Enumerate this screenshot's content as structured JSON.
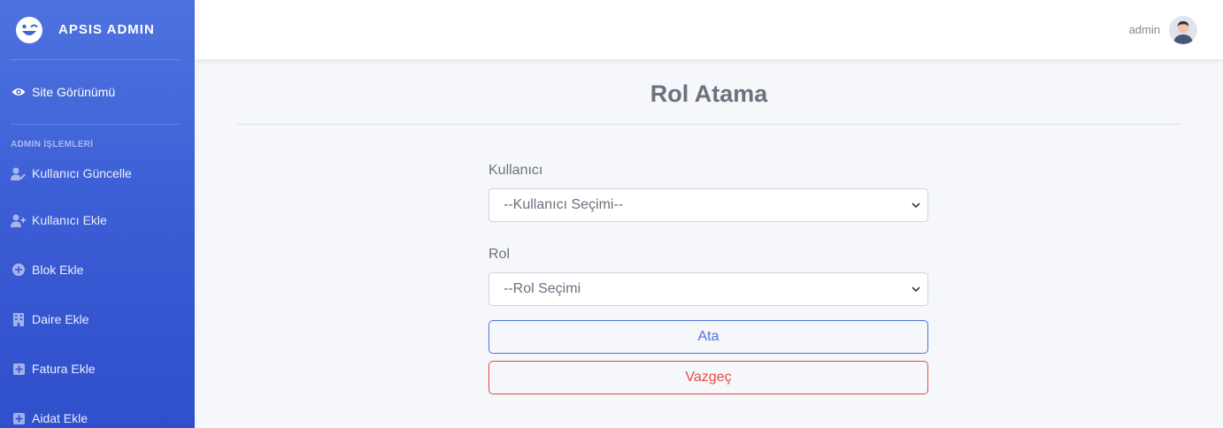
{
  "brand": {
    "name": "APSIS ADMIN"
  },
  "sidebar": {
    "active_item": {
      "label": "Site Görünümü",
      "icon": "eye-icon"
    },
    "heading": "ADMIN İŞLEMLERİ",
    "items": [
      {
        "label": "Kullanıcı Güncelle",
        "icon": "user-edit-icon"
      },
      {
        "label": "Kullanıcı Ekle",
        "icon": "user-plus-icon"
      },
      {
        "label": "Blok Ekle",
        "icon": "plus-circle-icon"
      },
      {
        "label": "Daire Ekle",
        "icon": "building-icon"
      },
      {
        "label": "Fatura Ekle",
        "icon": "plus-square-icon"
      },
      {
        "label": "Aidat Ekle",
        "icon": "plus-square-icon"
      }
    ]
  },
  "topbar": {
    "username": "admin"
  },
  "page": {
    "title": "Rol Atama"
  },
  "form": {
    "user_label": "Kullanıcı",
    "user_select_value": "--Kullanıcı Seçimi--",
    "role_label": "Rol",
    "role_select_value": "--Rol Seçimi",
    "assign_button": "Ata",
    "cancel_button": "Vazgeç"
  },
  "colors": {
    "sidebar_primary": "#4e73df",
    "primary": "#4e73df",
    "danger": "#e74a3b",
    "text_muted": "#6e707e"
  }
}
